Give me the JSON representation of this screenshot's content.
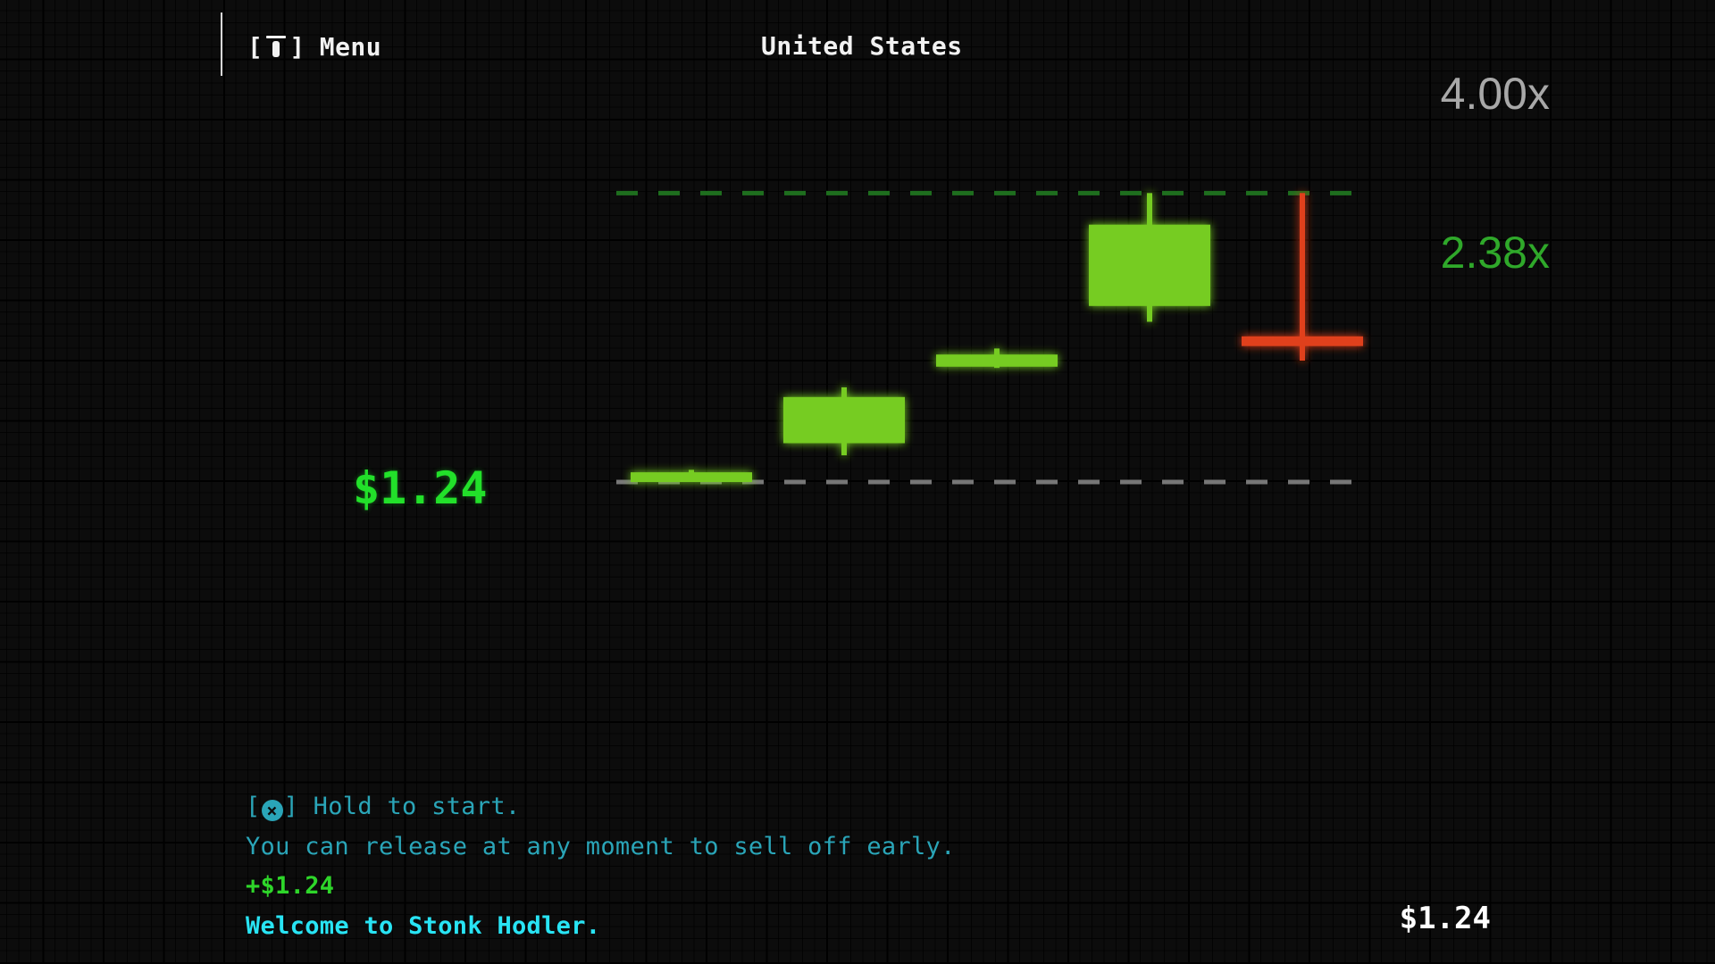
{
  "header": {
    "menu_label": "Menu",
    "menu_icon": "options-button-icon",
    "country": "United States"
  },
  "multipliers": {
    "top": "4.00x",
    "target": "2.38x"
  },
  "current_price": "$1.24",
  "log": {
    "hint_prefix": "[",
    "hint_icon": "cross-button-icon",
    "hint_suffix": "] Hold to start.",
    "release_hint": "You can release at any moment to sell off early.",
    "gain": "+$1.24",
    "welcome": "Welcome to Stonk Hodler."
  },
  "balance": "$1.24",
  "colors": {
    "background": "#0c0c0c",
    "candle_up": "#76cc22",
    "candle_down": "#e0401a",
    "base_line": "#66d61e",
    "target_line": "#1e6e1e",
    "floor_line": "#777777",
    "price_text": "#22e02a",
    "hint_text": "#2aa5b8",
    "welcome_text": "#28e4f4"
  },
  "chart_data": {
    "type": "candlestick",
    "y_unit": "multiplier",
    "base_level": 1.0,
    "target_level": 2.38,
    "floor_level": 0.0,
    "candles": [
      {
        "open": 0.0,
        "close": 0.08,
        "high": 0.1,
        "low": 0.0,
        "direction": "up"
      },
      {
        "open": 0.32,
        "close": 0.7,
        "high": 0.78,
        "low": 0.22,
        "direction": "up"
      },
      {
        "open": 0.95,
        "close": 1.05,
        "high": 1.1,
        "low": 0.94,
        "direction": "up"
      },
      {
        "open": 1.45,
        "close": 2.12,
        "high": 2.38,
        "low": 1.32,
        "direction": "up"
      },
      {
        "open": 1.2,
        "close": 1.12,
        "high": 2.38,
        "low": 1.0,
        "direction": "down"
      }
    ]
  }
}
